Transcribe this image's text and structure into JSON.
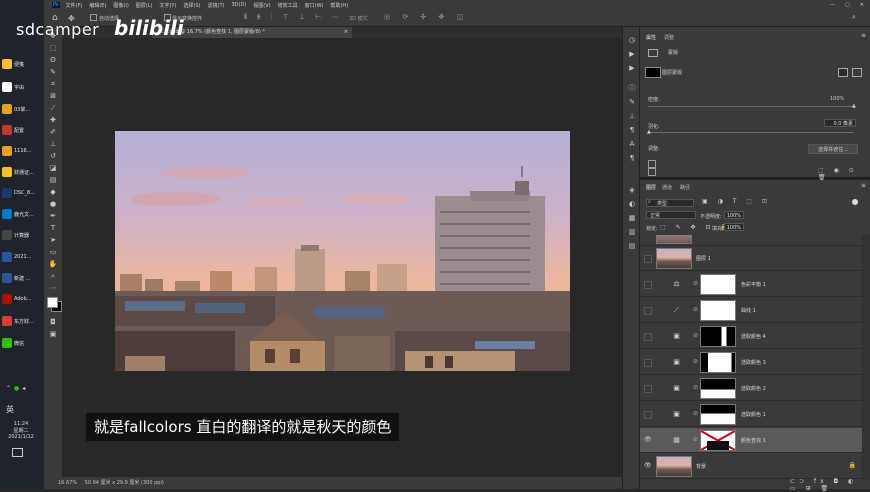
{
  "watermark": {
    "channel": "sdcamper",
    "site": "bilibili"
  },
  "taskbar": {
    "items": [
      {
        "label": "便笺",
        "color": "#f6c12a"
      },
      {
        "label": "字由",
        "color": "#ffffff"
      },
      {
        "label": "03掌...",
        "color": "#e5a21b"
      },
      {
        "label": "配置",
        "color": "#c0392b"
      },
      {
        "label": "1116...",
        "color": "#e5a21b"
      },
      {
        "label": "财通证...",
        "color": "#f0c419"
      },
      {
        "label": "DSC_8...",
        "color": "#1b3a6b"
      },
      {
        "label": "鹿光文...",
        "color": "#0078d4"
      },
      {
        "label": "计算器",
        "color": "#444444"
      },
      {
        "label": "2021...",
        "color": "#2b579a"
      },
      {
        "label": "新建 ...",
        "color": "#2b579a"
      },
      {
        "label": "Adob...",
        "color": "#b30b00"
      },
      {
        "label": "东方财...",
        "color": "#e03c31"
      },
      {
        "label": "微信",
        "color": "#2dc100"
      }
    ],
    "ime": "英",
    "time": "11:24",
    "weekday": "星期二",
    "date": "2021/1/12"
  },
  "menubar": {
    "items": [
      "文件(F)",
      "编辑(E)",
      "图像(I)",
      "图层(L)",
      "文字(Y)",
      "选择(S)",
      "滤镜(T)",
      "3D(D)",
      "视图(V)",
      "增效工具",
      "窗口(W)",
      "帮助(H)"
    ]
  },
  "optionsbar": {
    "auto_select": "自动选择",
    "transform_controls": "显示变换控件",
    "mode_3d": "3D 模式"
  },
  "document": {
    "tab_title": "...9.psd @ 16.7% (颜色查找 1, 图层蒙版/8) *",
    "status_zoom": "16.67%",
    "status_size": "50.94 厘米 x 29.9 厘米 (300 ppi)"
  },
  "subtitle": "就是fallcolors 直白的翻译的就是秋天的颜色",
  "properties": {
    "tabs": [
      "属性",
      "调整"
    ],
    "section": "蒙版",
    "mask_label": "图层蒙版",
    "density_label": "密度:",
    "density_value": "100%",
    "feather_label": "羽化:",
    "feather_value": "0.0 像素",
    "adjust_label": "调整:",
    "select_subject": "选择并遮住..."
  },
  "layers": {
    "tabs": [
      "图层",
      "通道",
      "路径"
    ],
    "filter_label": "类型",
    "blend_mode": "正常",
    "opacity_label": "不透明度:",
    "opacity_value": "100%",
    "lock_label": "锁定:",
    "fill_label": "填充:",
    "fill_value": "100%",
    "items": [
      {
        "name": "图层 1",
        "kind": "photo"
      },
      {
        "name": "色彩平衡 1",
        "kind": "adj"
      },
      {
        "name": "曲线 1",
        "kind": "adj"
      },
      {
        "name": "选取颜色 4",
        "kind": "adj"
      },
      {
        "name": "选取颜色 3",
        "kind": "adj"
      },
      {
        "name": "选取颜色 2",
        "kind": "adj"
      },
      {
        "name": "选取颜色 1",
        "kind": "adj"
      },
      {
        "name": "颜色查找 1",
        "kind": "adj"
      },
      {
        "name": "背景",
        "kind": "photo"
      }
    ]
  }
}
